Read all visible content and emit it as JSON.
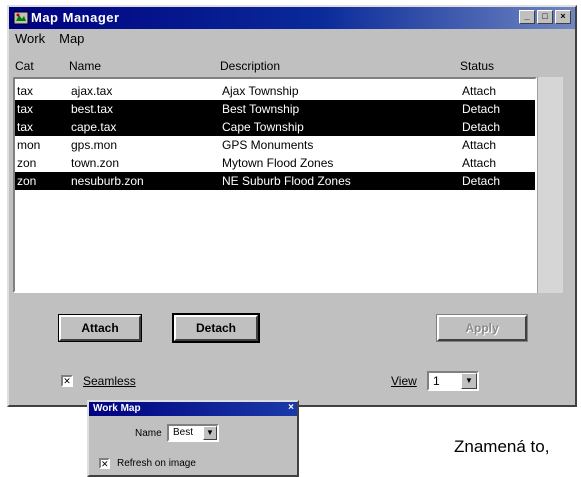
{
  "window": {
    "title": "Map Manager"
  },
  "menu": [
    "Work",
    "Map"
  ],
  "columns": {
    "cat": "Cat",
    "name": "Name",
    "description": "Description",
    "status": "Status"
  },
  "rows": [
    {
      "cat": "tax",
      "name": "ajax.tax",
      "description": "Ajax Township",
      "status": "Attach",
      "selected": false
    },
    {
      "cat": "tax",
      "name": "best.tax",
      "description": "Best Township",
      "status": "Detach",
      "selected": true
    },
    {
      "cat": "tax",
      "name": "cape.tax",
      "description": "Cape Township",
      "status": "Detach",
      "selected": true
    },
    {
      "cat": "mon",
      "name": "gps.mon",
      "description": "GPS Monuments",
      "status": "Attach",
      "selected": false
    },
    {
      "cat": "zon",
      "name": "town.zon",
      "description": "Mytown Flood Zones",
      "status": "Attach",
      "selected": false
    },
    {
      "cat": "zon",
      "name": "nesuburb.zon",
      "description": "NE Suburb Flood Zones",
      "status": "Detach",
      "selected": true
    }
  ],
  "buttons": {
    "attach": "Attach",
    "detach": "Detach",
    "apply": "Apply"
  },
  "seamless": {
    "label": "Seamless",
    "checked": true
  },
  "view": {
    "label": "View",
    "value": "1"
  },
  "sub_window": {
    "title": "Work Map",
    "name_label": "Name",
    "name_value": "Best",
    "checkbox_label": "Refresh on image",
    "checkbox_checked": true
  },
  "caption": "Znamená to,",
  "colors": {
    "titlebar": "#000080",
    "selection": "#000000",
    "face": "#c0c0c0"
  }
}
